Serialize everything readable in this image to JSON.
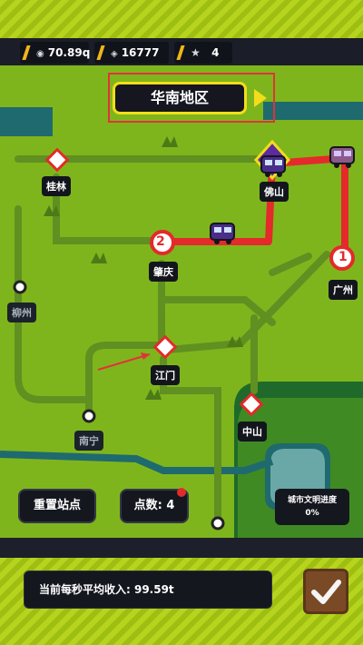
{
  "hud": {
    "currency_value": "70.89q",
    "gems_value": "16777",
    "stars_value": "4"
  },
  "region": {
    "title": "华南地区"
  },
  "cities": {
    "guilin": "桂林",
    "foshan": "佛山",
    "zhaoqing": "肇庆",
    "guangzhou": "广州",
    "liuzhou": "柳州",
    "jiangmen": "江门",
    "nanning": "南宁",
    "zhongshan": "中山"
  },
  "stations": {
    "station_1": "1",
    "station_2": "2"
  },
  "buttons": {
    "reset_stations": "重置站点",
    "points": "点数: 4"
  },
  "civilization": {
    "label": "城市文明进度",
    "value": "0%"
  },
  "income": {
    "label": "当前每秒平均收入: 99.59t"
  },
  "colors": {
    "grass": "#7fb51c",
    "route": "#e42a2a",
    "accent": "#f3dd1a",
    "water": "#1f6a6e"
  }
}
